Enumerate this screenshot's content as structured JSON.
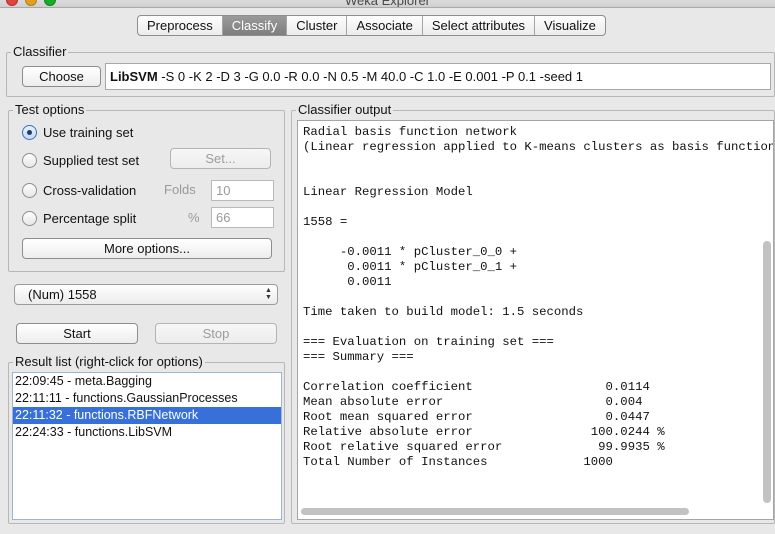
{
  "window": {
    "title": "Weka Explorer"
  },
  "tabs": [
    "Preprocess",
    "Classify",
    "Cluster",
    "Associate",
    "Select attributes",
    "Visualize"
  ],
  "active_tab": "Classify",
  "classifier": {
    "group_title": "Classifier",
    "choose_label": "Choose",
    "name": "LibSVM",
    "options": " -S 0 -K 2 -D 3 -G 0.0 -R 0.0 -N 0.5 -M 40.0 -C 1.0 -E 0.001 -P 0.1 -seed 1"
  },
  "test_options": {
    "group_title": "Test options",
    "use_training_set": "Use training set",
    "supplied_test_set": "Supplied test set",
    "set_button": "Set...",
    "cross_validation": "Cross-validation",
    "folds_label": "Folds",
    "folds_value": "10",
    "percentage_split": "Percentage split",
    "percent_label": "%",
    "percent_value": "66",
    "more_options": "More options...",
    "selected": "Use training set"
  },
  "class_select": {
    "value": "(Num) 1558"
  },
  "buttons": {
    "start": "Start",
    "stop": "Stop"
  },
  "result_list": {
    "group_title": "Result list (right-click for options)",
    "items": [
      "22:09:45 - meta.Bagging",
      "22:11:11 - functions.GaussianProcesses",
      "22:11:32 - functions.RBFNetwork",
      "22:24:33 - functions.LibSVM"
    ],
    "selected_index": 2
  },
  "output": {
    "group_title": "Classifier output",
    "text": "Radial basis function network\n(Linear regression applied to K-means clusters as basis functions)\n\n\nLinear Regression Model\n\n1558 =\n\n     -0.0011 * pCluster_0_0 +\n      0.0011 * pCluster_0_1 +\n      0.0011\n\nTime taken to build model: 1.5 seconds\n\n=== Evaluation on training set ===\n=== Summary ===\n\nCorrelation coefficient                  0.0114\nMean absolute error                      0.004 \nRoot mean squared error                  0.0447\nRelative absolute error                100.0244 %\nRoot relative squared error             99.9935 %\nTotal Number of Instances             1000     "
  }
}
